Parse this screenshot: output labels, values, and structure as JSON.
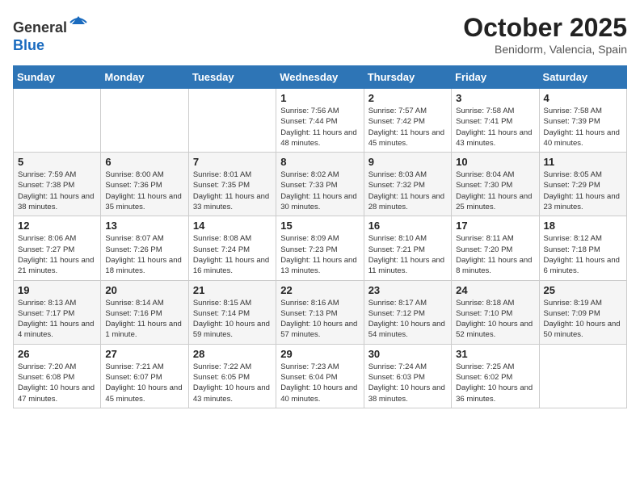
{
  "header": {
    "logo_general": "General",
    "logo_blue": "Blue",
    "month_title": "October 2025",
    "location": "Benidorm, Valencia, Spain"
  },
  "weekdays": [
    "Sunday",
    "Monday",
    "Tuesday",
    "Wednesday",
    "Thursday",
    "Friday",
    "Saturday"
  ],
  "weeks": [
    [
      {
        "day": "",
        "sunrise": "",
        "sunset": "",
        "daylight": ""
      },
      {
        "day": "",
        "sunrise": "",
        "sunset": "",
        "daylight": ""
      },
      {
        "day": "",
        "sunrise": "",
        "sunset": "",
        "daylight": ""
      },
      {
        "day": "1",
        "sunrise": "Sunrise: 7:56 AM",
        "sunset": "Sunset: 7:44 PM",
        "daylight": "Daylight: 11 hours and 48 minutes."
      },
      {
        "day": "2",
        "sunrise": "Sunrise: 7:57 AM",
        "sunset": "Sunset: 7:42 PM",
        "daylight": "Daylight: 11 hours and 45 minutes."
      },
      {
        "day": "3",
        "sunrise": "Sunrise: 7:58 AM",
        "sunset": "Sunset: 7:41 PM",
        "daylight": "Daylight: 11 hours and 43 minutes."
      },
      {
        "day": "4",
        "sunrise": "Sunrise: 7:58 AM",
        "sunset": "Sunset: 7:39 PM",
        "daylight": "Daylight: 11 hours and 40 minutes."
      }
    ],
    [
      {
        "day": "5",
        "sunrise": "Sunrise: 7:59 AM",
        "sunset": "Sunset: 7:38 PM",
        "daylight": "Daylight: 11 hours and 38 minutes."
      },
      {
        "day": "6",
        "sunrise": "Sunrise: 8:00 AM",
        "sunset": "Sunset: 7:36 PM",
        "daylight": "Daylight: 11 hours and 35 minutes."
      },
      {
        "day": "7",
        "sunrise": "Sunrise: 8:01 AM",
        "sunset": "Sunset: 7:35 PM",
        "daylight": "Daylight: 11 hours and 33 minutes."
      },
      {
        "day": "8",
        "sunrise": "Sunrise: 8:02 AM",
        "sunset": "Sunset: 7:33 PM",
        "daylight": "Daylight: 11 hours and 30 minutes."
      },
      {
        "day": "9",
        "sunrise": "Sunrise: 8:03 AM",
        "sunset": "Sunset: 7:32 PM",
        "daylight": "Daylight: 11 hours and 28 minutes."
      },
      {
        "day": "10",
        "sunrise": "Sunrise: 8:04 AM",
        "sunset": "Sunset: 7:30 PM",
        "daylight": "Daylight: 11 hours and 25 minutes."
      },
      {
        "day": "11",
        "sunrise": "Sunrise: 8:05 AM",
        "sunset": "Sunset: 7:29 PM",
        "daylight": "Daylight: 11 hours and 23 minutes."
      }
    ],
    [
      {
        "day": "12",
        "sunrise": "Sunrise: 8:06 AM",
        "sunset": "Sunset: 7:27 PM",
        "daylight": "Daylight: 11 hours and 21 minutes."
      },
      {
        "day": "13",
        "sunrise": "Sunrise: 8:07 AM",
        "sunset": "Sunset: 7:26 PM",
        "daylight": "Daylight: 11 hours and 18 minutes."
      },
      {
        "day": "14",
        "sunrise": "Sunrise: 8:08 AM",
        "sunset": "Sunset: 7:24 PM",
        "daylight": "Daylight: 11 hours and 16 minutes."
      },
      {
        "day": "15",
        "sunrise": "Sunrise: 8:09 AM",
        "sunset": "Sunset: 7:23 PM",
        "daylight": "Daylight: 11 hours and 13 minutes."
      },
      {
        "day": "16",
        "sunrise": "Sunrise: 8:10 AM",
        "sunset": "Sunset: 7:21 PM",
        "daylight": "Daylight: 11 hours and 11 minutes."
      },
      {
        "day": "17",
        "sunrise": "Sunrise: 8:11 AM",
        "sunset": "Sunset: 7:20 PM",
        "daylight": "Daylight: 11 hours and 8 minutes."
      },
      {
        "day": "18",
        "sunrise": "Sunrise: 8:12 AM",
        "sunset": "Sunset: 7:18 PM",
        "daylight": "Daylight: 11 hours and 6 minutes."
      }
    ],
    [
      {
        "day": "19",
        "sunrise": "Sunrise: 8:13 AM",
        "sunset": "Sunset: 7:17 PM",
        "daylight": "Daylight: 11 hours and 4 minutes."
      },
      {
        "day": "20",
        "sunrise": "Sunrise: 8:14 AM",
        "sunset": "Sunset: 7:16 PM",
        "daylight": "Daylight: 11 hours and 1 minute."
      },
      {
        "day": "21",
        "sunrise": "Sunrise: 8:15 AM",
        "sunset": "Sunset: 7:14 PM",
        "daylight": "Daylight: 10 hours and 59 minutes."
      },
      {
        "day": "22",
        "sunrise": "Sunrise: 8:16 AM",
        "sunset": "Sunset: 7:13 PM",
        "daylight": "Daylight: 10 hours and 57 minutes."
      },
      {
        "day": "23",
        "sunrise": "Sunrise: 8:17 AM",
        "sunset": "Sunset: 7:12 PM",
        "daylight": "Daylight: 10 hours and 54 minutes."
      },
      {
        "day": "24",
        "sunrise": "Sunrise: 8:18 AM",
        "sunset": "Sunset: 7:10 PM",
        "daylight": "Daylight: 10 hours and 52 minutes."
      },
      {
        "day": "25",
        "sunrise": "Sunrise: 8:19 AM",
        "sunset": "Sunset: 7:09 PM",
        "daylight": "Daylight: 10 hours and 50 minutes."
      }
    ],
    [
      {
        "day": "26",
        "sunrise": "Sunrise: 7:20 AM",
        "sunset": "Sunset: 6:08 PM",
        "daylight": "Daylight: 10 hours and 47 minutes."
      },
      {
        "day": "27",
        "sunrise": "Sunrise: 7:21 AM",
        "sunset": "Sunset: 6:07 PM",
        "daylight": "Daylight: 10 hours and 45 minutes."
      },
      {
        "day": "28",
        "sunrise": "Sunrise: 7:22 AM",
        "sunset": "Sunset: 6:05 PM",
        "daylight": "Daylight: 10 hours and 43 minutes."
      },
      {
        "day": "29",
        "sunrise": "Sunrise: 7:23 AM",
        "sunset": "Sunset: 6:04 PM",
        "daylight": "Daylight: 10 hours and 40 minutes."
      },
      {
        "day": "30",
        "sunrise": "Sunrise: 7:24 AM",
        "sunset": "Sunset: 6:03 PM",
        "daylight": "Daylight: 10 hours and 38 minutes."
      },
      {
        "day": "31",
        "sunrise": "Sunrise: 7:25 AM",
        "sunset": "Sunset: 6:02 PM",
        "daylight": "Daylight: 10 hours and 36 minutes."
      },
      {
        "day": "",
        "sunrise": "",
        "sunset": "",
        "daylight": ""
      }
    ]
  ]
}
